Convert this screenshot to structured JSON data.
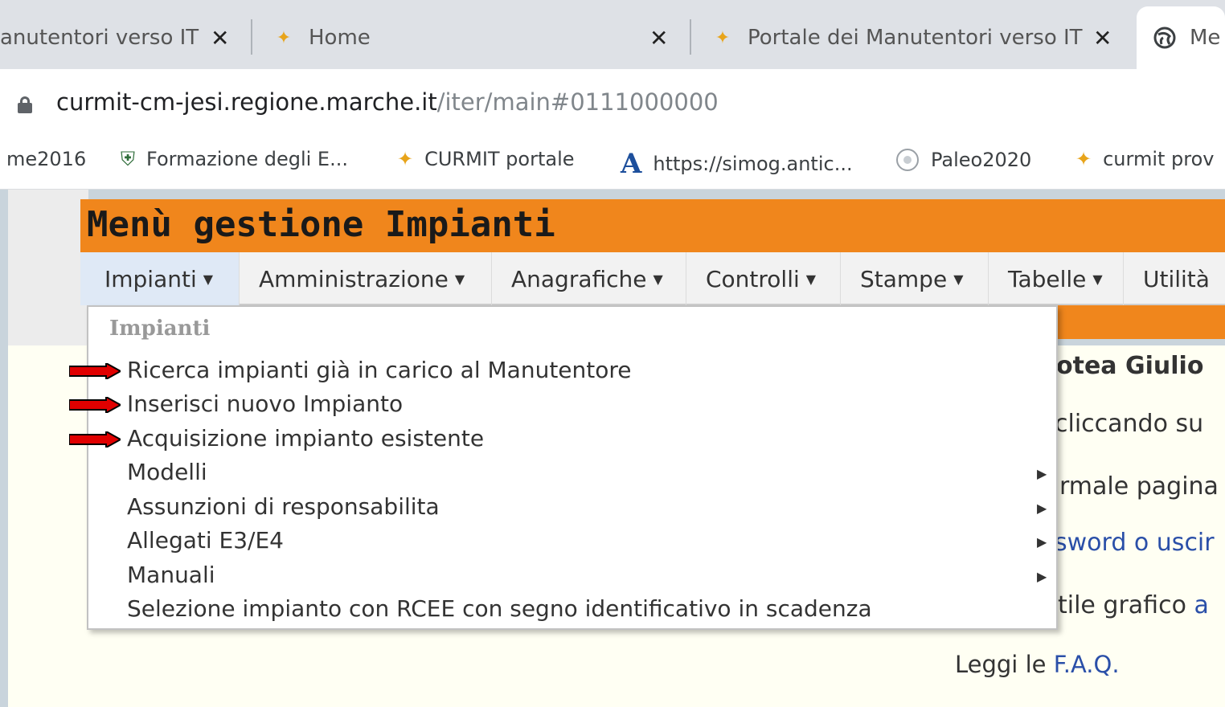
{
  "browser": {
    "tabs": [
      {
        "label": "anutentori verso IT",
        "icon": "curmit-logo-icon"
      },
      {
        "label": "Home",
        "icon": "curmit-logo-icon"
      },
      {
        "label": "Portale dei Manutentori verso IT",
        "icon": "curmit-logo-icon"
      },
      {
        "label": "Me",
        "icon": "globe-icon"
      }
    ],
    "close_glyph": "✕",
    "url_host": "curmit-cm-jesi.regione.marche.it",
    "url_path": "/iter/main#0111000000",
    "bookmarks": [
      {
        "label": "me2016",
        "icon": ""
      },
      {
        "label": "Formazione degli E...",
        "icon": "shield-icon"
      },
      {
        "label": "CURMIT portale",
        "icon": "curmit-logo-icon"
      },
      {
        "label": "https://simog.antic...",
        "icon": "anac-logo-icon"
      },
      {
        "label": "Paleo2020",
        "icon": "paleo-icon"
      },
      {
        "label": "curmit prov",
        "icon": "curmit-logo-icon"
      }
    ]
  },
  "page": {
    "title": "Menù gestione Impianti",
    "menu": [
      {
        "label": "Impianti"
      },
      {
        "label": "Amministrazione"
      },
      {
        "label": "Anagrafiche"
      },
      {
        "label": "Controlli"
      },
      {
        "label": "Stampe"
      },
      {
        "label": "Tabelle"
      },
      {
        "label": "Utilità"
      }
    ],
    "dropdown": {
      "heading": "Impianti",
      "items": [
        {
          "label": "Ricerca impianti già in carico al Manutentore",
          "highlight_arrow": true,
          "submenu": false
        },
        {
          "label": "Inserisci nuovo Impianto",
          "highlight_arrow": true,
          "submenu": false
        },
        {
          "label": "Acquisizione impianto esistente",
          "highlight_arrow": true,
          "submenu": false
        },
        {
          "label": "Modelli",
          "highlight_arrow": false,
          "submenu": true
        },
        {
          "label": "Assunzioni di responsabilita",
          "highlight_arrow": false,
          "submenu": true
        },
        {
          "label": "Allegati E3/E4",
          "highlight_arrow": false,
          "submenu": true
        },
        {
          "label": "Manuali",
          "highlight_arrow": false,
          "submenu": true
        },
        {
          "label": "Selezione impianto con RCEE con segno identificativo in scadenza",
          "highlight_arrow": false,
          "submenu": false
        }
      ]
    },
    "background_text": {
      "name": "otea Giulio",
      "line1": "cliccando su",
      "line2": "rmale pagina",
      "line3": "sword o uscir",
      "line4_prefix": "tile grafico ",
      "line4_link": "a",
      "faq_prefix": "Leggi le ",
      "faq_link": "F.A.Q."
    }
  },
  "colors": {
    "accent_orange": "#f0861c",
    "arrow_red": "#e00000",
    "link_blue": "#2a4fa8"
  }
}
